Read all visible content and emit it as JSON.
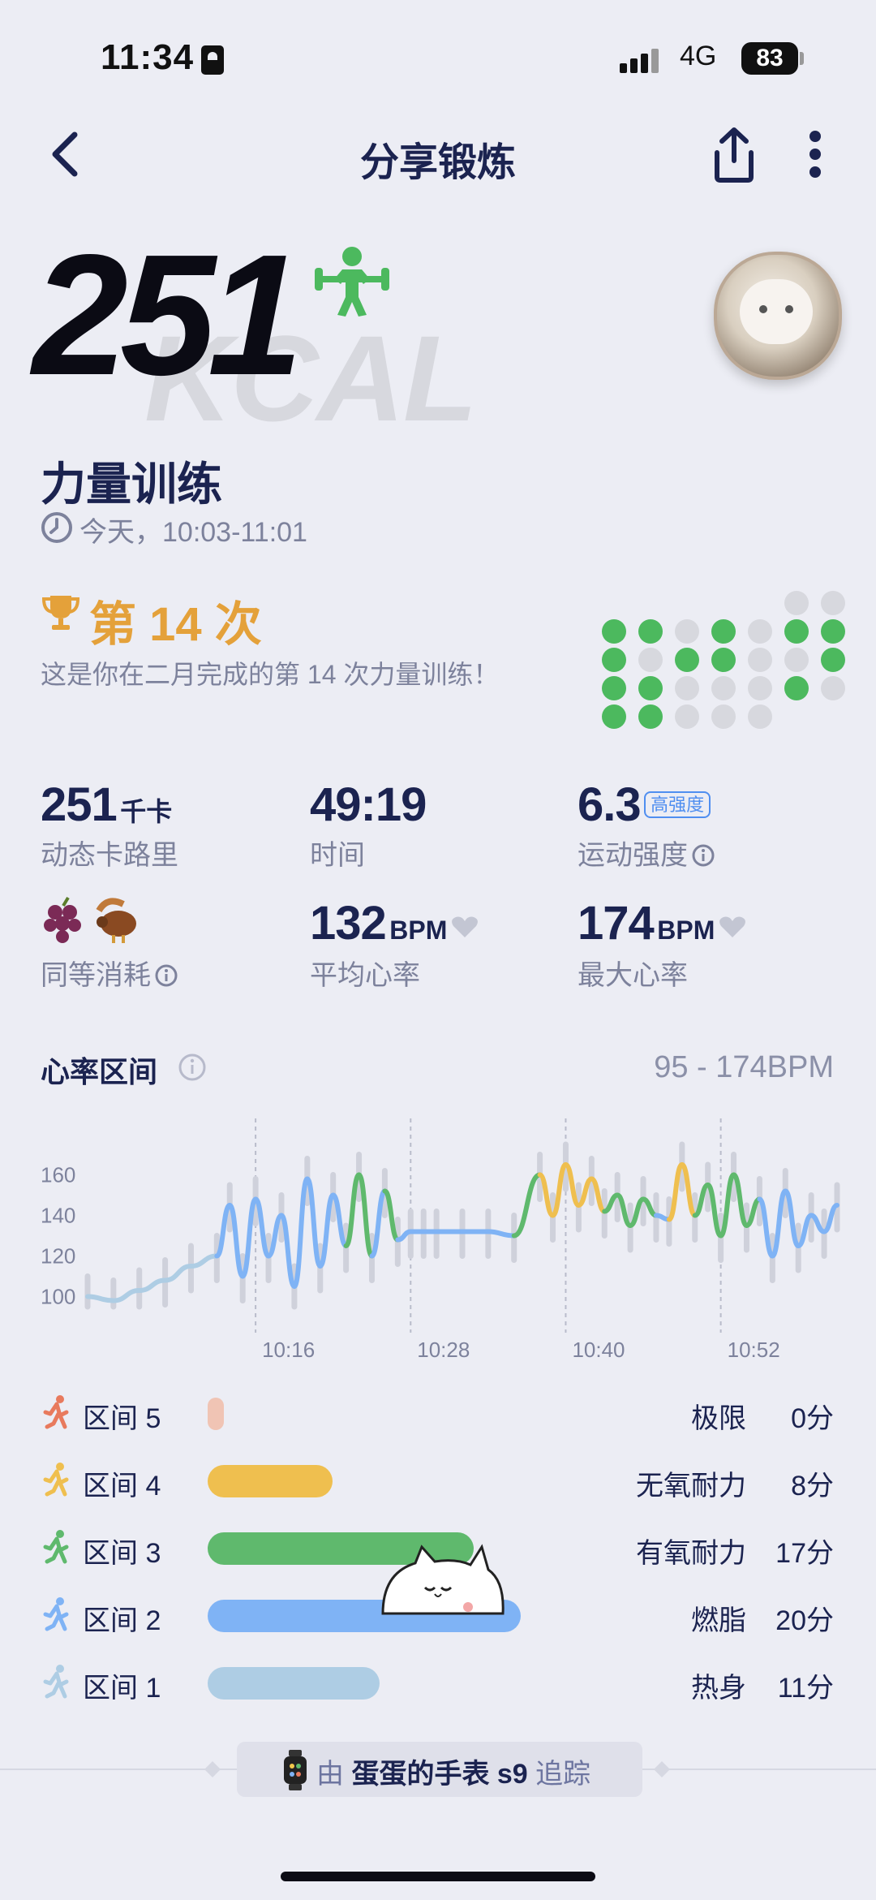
{
  "status_bar": {
    "time": "11:34",
    "network": "4G",
    "battery": "83"
  },
  "nav": {
    "title": "分享锻炼"
  },
  "hero": {
    "calories": "251",
    "unit_watermark": "KCAL"
  },
  "workout": {
    "title": "力量训练",
    "time": "今天，10:03-11:01"
  },
  "streak": {
    "title": "第 14 次",
    "subtitle": "这是你在二月完成的第 14 次力量训练！"
  },
  "stats": {
    "calories_value": "251",
    "calories_unit": "千卡",
    "calories_label": "动态卡路里",
    "duration_value": "49:19",
    "duration_label": "时间",
    "intensity_value": "6.3",
    "intensity_badge": "高强度",
    "intensity_label": "运动强度",
    "equivalent_label": "同等消耗",
    "avg_hr_value": "132",
    "avg_hr_unit": "BPM",
    "avg_hr_label": "平均心率",
    "max_hr_value": "174",
    "max_hr_unit": "BPM",
    "max_hr_label": "最大心率"
  },
  "heart_zone": {
    "title": "心率区间",
    "range": "95 - 174BPM"
  },
  "chart_data": {
    "type": "line",
    "title": "",
    "y_ticks": [
      "160",
      "140",
      "120",
      "100"
    ],
    "x_ticks": [
      "10:16",
      "10:28",
      "10:40",
      "10:52"
    ],
    "ylim": [
      95,
      175
    ],
    "series": [
      {
        "x": [
          "10:03",
          "10:05",
          "10:07",
          "10:09",
          "10:11",
          "10:13",
          "10:14",
          "10:15",
          "10:16",
          "10:17",
          "10:18",
          "10:19",
          "10:20",
          "10:21",
          "10:22",
          "10:23",
          "10:24",
          "10:25",
          "10:26",
          "10:27",
          "10:28",
          "10:29",
          "10:30",
          "10:32",
          "10:34",
          "10:36",
          "10:38",
          "10:39",
          "10:40",
          "10:41",
          "10:42",
          "10:43",
          "10:44",
          "10:45",
          "10:46",
          "10:47",
          "10:48",
          "10:49",
          "10:50",
          "10:51",
          "10:52",
          "10:53",
          "10:54",
          "10:55",
          "10:56",
          "10:57",
          "10:58",
          "10:59",
          "11:00",
          "11:01"
        ],
        "values": [
          100,
          98,
          103,
          108,
          115,
          120,
          145,
          110,
          148,
          120,
          140,
          105,
          158,
          115,
          150,
          125,
          160,
          120,
          152,
          128,
          132,
          132,
          132,
          132,
          132,
          130,
          160,
          140,
          165,
          145,
          158,
          142,
          150,
          135,
          148,
          140,
          138,
          165,
          140,
          155,
          130,
          160,
          135,
          148,
          120,
          152,
          125,
          140,
          132,
          145
        ]
      }
    ]
  },
  "zones": [
    {
      "label": "区间 5",
      "name": "极限",
      "minutes": "0分",
      "color": "#f0c4b4",
      "fraction": 0.0
    },
    {
      "label": "区间 4",
      "name": "无氧耐力",
      "minutes": "8分",
      "color": "#efbf4f",
      "fraction": 0.4
    },
    {
      "label": "区间 3",
      "name": "有氧耐力",
      "minutes": "17分",
      "color": "#5fb96d",
      "fraction": 0.85
    },
    {
      "label": "区间 2",
      "name": "燃脂",
      "minutes": "20分",
      "color": "#7fb3f5",
      "fraction": 1.0
    },
    {
      "label": "区间 1",
      "name": "热身",
      "minutes": "11分",
      "color": "#aecde4",
      "fraction": 0.55
    }
  ],
  "footer": {
    "prefix": "由",
    "device": "蛋蛋的手表 s9",
    "suffix": "追踪"
  }
}
